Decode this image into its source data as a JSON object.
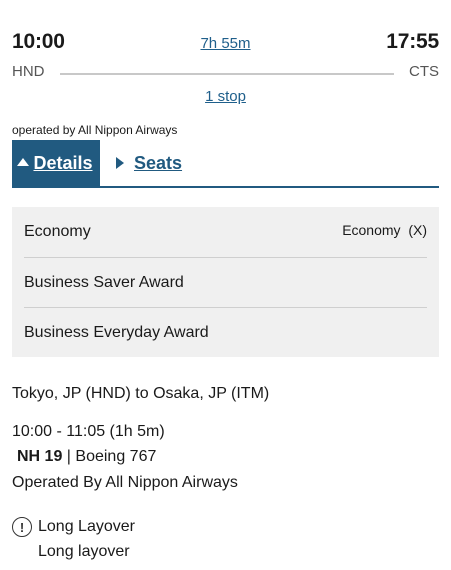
{
  "flight": {
    "departure_time": "10:00",
    "arrival_time": "17:55",
    "duration": "7h 55m",
    "departure_airport": "HND",
    "arrival_airport": "CTS",
    "stops": "1 stop",
    "operated_by": "operated by All Nippon Airways"
  },
  "tabs": [
    {
      "label": "Details",
      "active": true
    },
    {
      "label": "Seats",
      "active": false
    }
  ],
  "fares": {
    "rows": [
      {
        "name": "Economy",
        "code": "Economy  (X)"
      },
      {
        "name": "Business Saver Award",
        "code": ""
      },
      {
        "name": "Business Everyday Award",
        "code": ""
      }
    ]
  },
  "leg": {
    "route": "Tokyo, JP (HND) to Osaka, JP (ITM)",
    "times": "10:00 - 11:05 (1h 5m)",
    "flight_number": "NH 19",
    "aircraft": " | Boeing 767",
    "operated_by": "Operated By All Nippon Airways"
  },
  "layover": {
    "title": "Long Layover",
    "detail": "Long layover",
    "icon": "exclamation-circle-icon"
  },
  "colors": {
    "accent": "#215a80",
    "link": "#1f5f8b",
    "fare_bg": "#f0f0f0"
  }
}
